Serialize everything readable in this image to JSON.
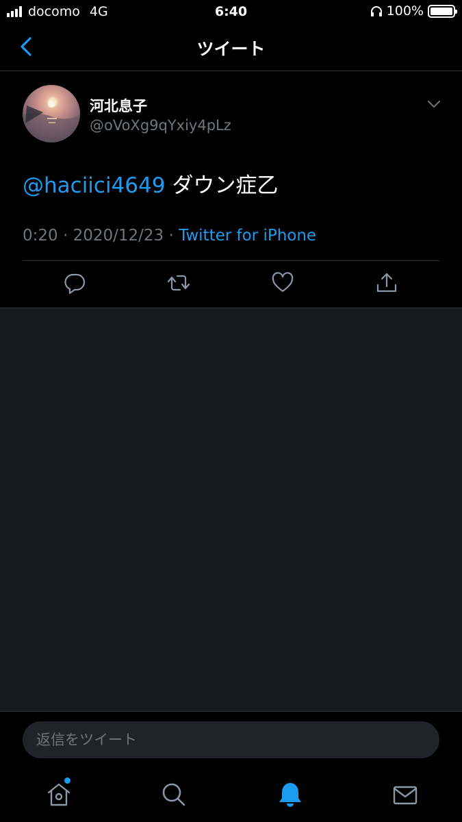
{
  "status_bar": {
    "carrier": "docomo",
    "network": "4G",
    "time": "6:40",
    "battery": "100%"
  },
  "nav": {
    "title": "ツイート"
  },
  "tweet": {
    "display_name": "河北息子",
    "handle": "@oVoXg9qYxiy4pLz",
    "mention": "@haciici4649",
    "text": " ダウン症乙",
    "time": "0:20",
    "separator1": " · ",
    "date": "2020/12/23",
    "separator2": " · ",
    "source": "Twitter for iPhone"
  },
  "reply": {
    "placeholder": "返信をツイート"
  },
  "colors": {
    "accent": "#1d9bf0",
    "secondary_text": "#71767b",
    "background": "#000000",
    "empty_area": "#16181c"
  },
  "icons": {
    "back": "chevron-left-icon",
    "more": "chevron-down-icon",
    "reply": "reply-bubble-icon",
    "retweet": "retweet-icon",
    "like": "heart-icon",
    "share": "share-icon",
    "home": "home-icon",
    "search": "search-icon",
    "notifications": "bell-icon",
    "messages": "mail-icon"
  }
}
